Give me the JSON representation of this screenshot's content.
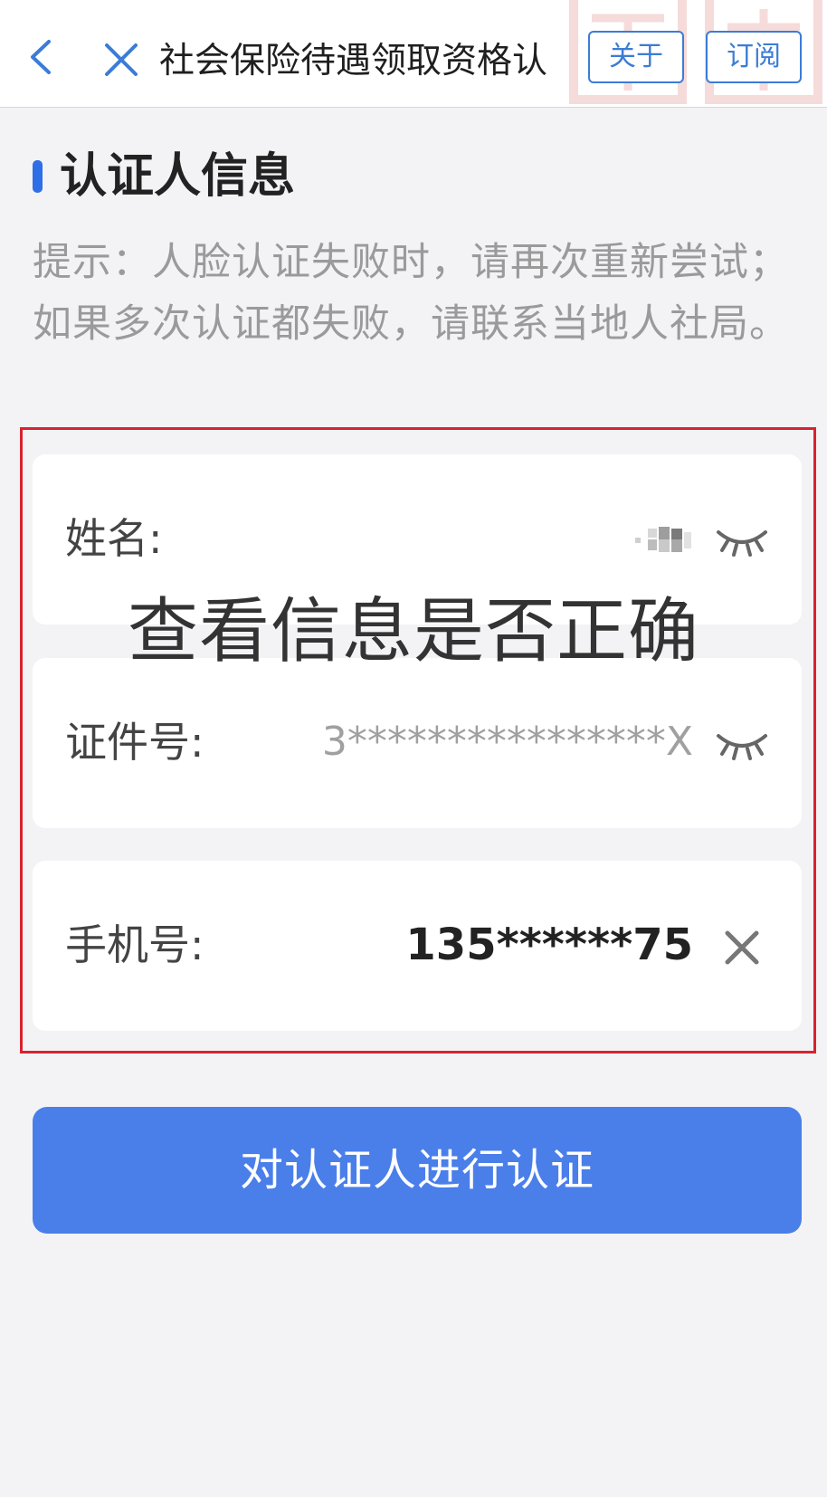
{
  "nav": {
    "title": "社会保险待遇领取资格认",
    "about_label": "关于",
    "subscribe_label": "订阅"
  },
  "section": {
    "title": "认证人信息",
    "hint": "提示：人脸认证失败时，请再次重新尝试；如果多次认证都失败，请联系当地人社局。"
  },
  "fields": {
    "name": {
      "label": "姓名:",
      "value_hidden": true
    },
    "id_number": {
      "label": "证件号:",
      "value": "3****************X"
    },
    "phone": {
      "label": "手机号:",
      "value": "135******75"
    }
  },
  "overlay_caption": "查看信息是否正确",
  "actions": {
    "verify_label": "对认证人进行认证"
  },
  "colors": {
    "accent": "#2f6fe6",
    "button": "#4a7fea",
    "nav_button": "#3b7cd6",
    "highlight_frame": "#d9222f",
    "background": "#f3f3f5"
  },
  "icons": {
    "back": "chevron-left-icon",
    "close": "close-icon",
    "eye_closed": "eye-closed-icon",
    "clear": "clear-icon"
  }
}
